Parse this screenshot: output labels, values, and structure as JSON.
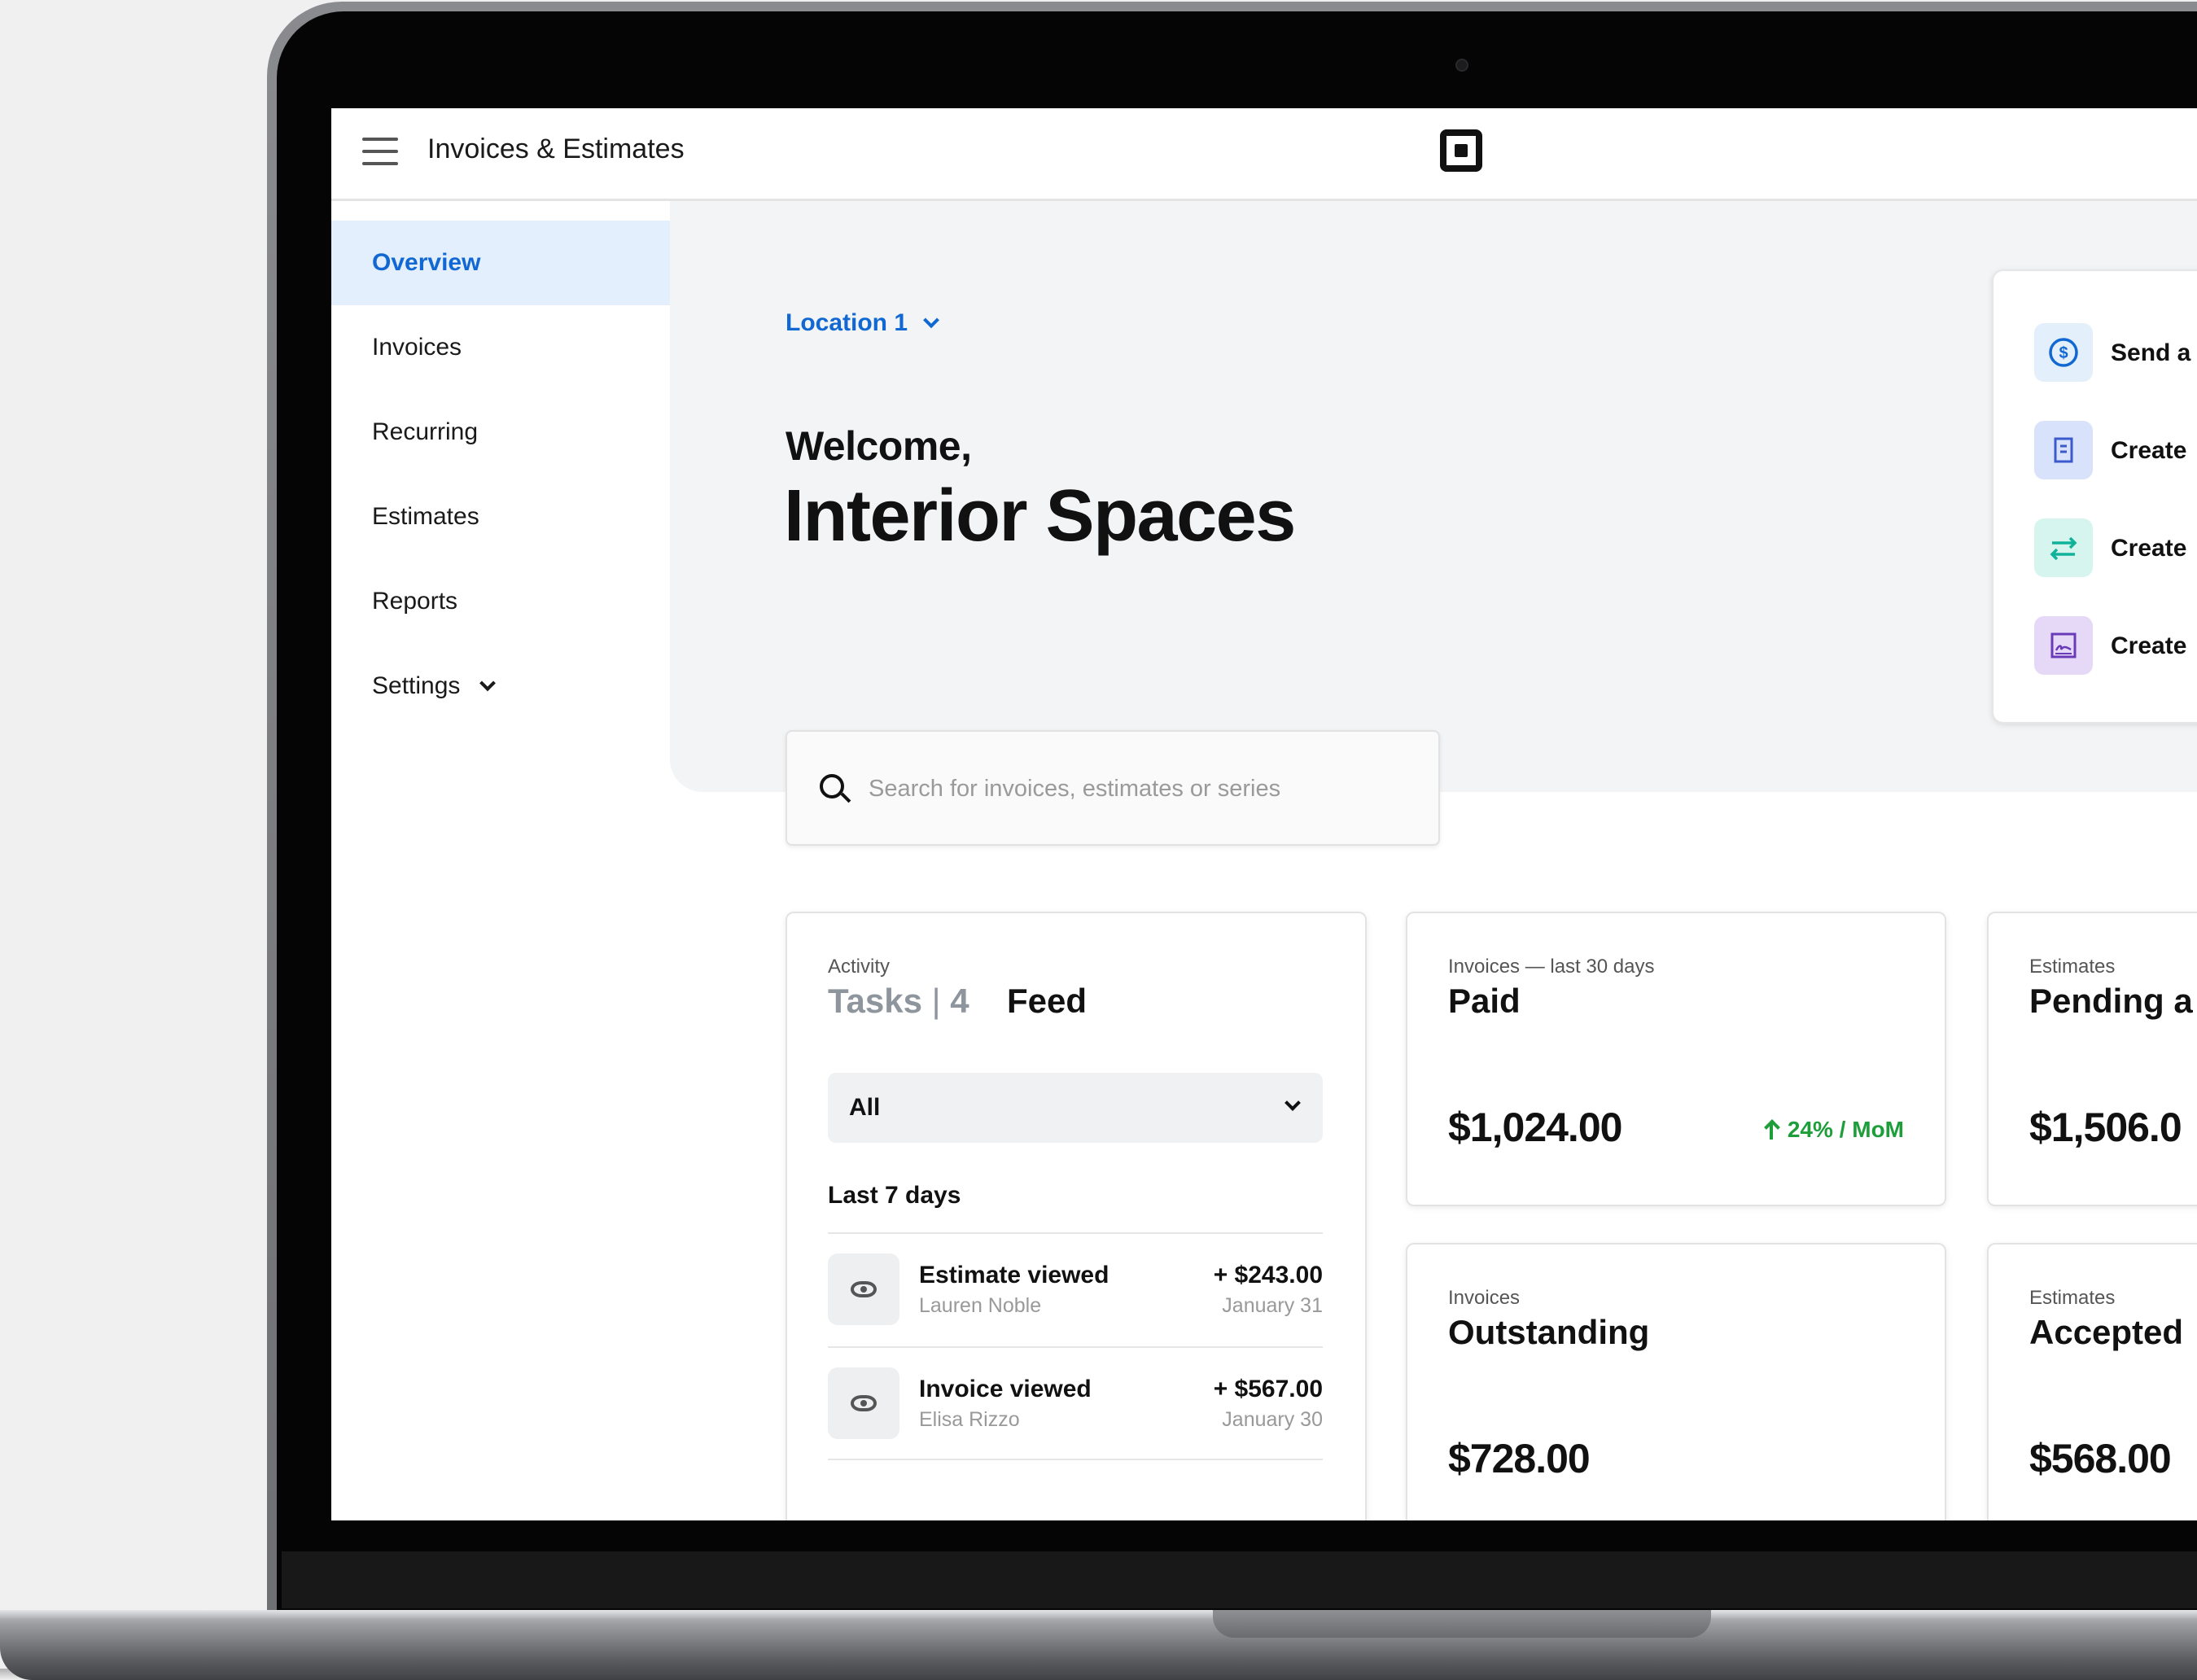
{
  "header": {
    "app_title": "Invoices & Estimates"
  },
  "sidebar": {
    "items": [
      {
        "label": "Overview"
      },
      {
        "label": "Invoices"
      },
      {
        "label": "Recurring"
      },
      {
        "label": "Estimates"
      },
      {
        "label": "Reports"
      },
      {
        "label": "Settings"
      }
    ],
    "active": "Overview"
  },
  "main": {
    "location": "Location 1",
    "welcome": "Welcome,",
    "business_name": "Interior Spaces",
    "search_placeholder": "Search for invoices, estimates or series"
  },
  "quick_actions": [
    {
      "label": "Send a",
      "icon": "dollar-circle-icon",
      "color": "#e3f0fb"
    },
    {
      "label": "Create",
      "icon": "document-icon",
      "color": "#d9e2fb"
    },
    {
      "label": "Create",
      "icon": "swap-arrows-icon",
      "color": "#d6f5ef"
    },
    {
      "label": "Create",
      "icon": "signature-icon",
      "color": "#e6d9f7"
    }
  ],
  "activity": {
    "overline": "Activity",
    "tasks_label": "Tasks",
    "separator": "|",
    "tasks_count": "4",
    "feed_label": "Feed",
    "filter_value": "All",
    "section": "Last 7 days",
    "rows": [
      {
        "title": "Estimate viewed",
        "name": "Lauren Noble",
        "amount": "+ $243.00",
        "date": "January 31"
      },
      {
        "title": "Invoice viewed",
        "name": "Elisa Rizzo",
        "amount": "+ $567.00",
        "date": "January 30"
      }
    ]
  },
  "stats": {
    "paid": {
      "overline": "Invoices — last 30 days",
      "title": "Paid",
      "amount": "$1,024.00",
      "trend": "24% / MoM"
    },
    "pending": {
      "overline": "Estimates",
      "title": "Pending a",
      "amount": "$1,506.0"
    },
    "outstanding": {
      "overline": "Invoices",
      "title": "Outstanding",
      "amount": "$728.00"
    },
    "accepted": {
      "overline": "Estimates",
      "title": "Accepted",
      "amount": "$568.00"
    }
  },
  "colors": {
    "accent": "#1268d3",
    "active_nav_bg": "#e3effc",
    "trend_up": "#1e9e3a",
    "hero_bg": "#f3f4f6"
  }
}
